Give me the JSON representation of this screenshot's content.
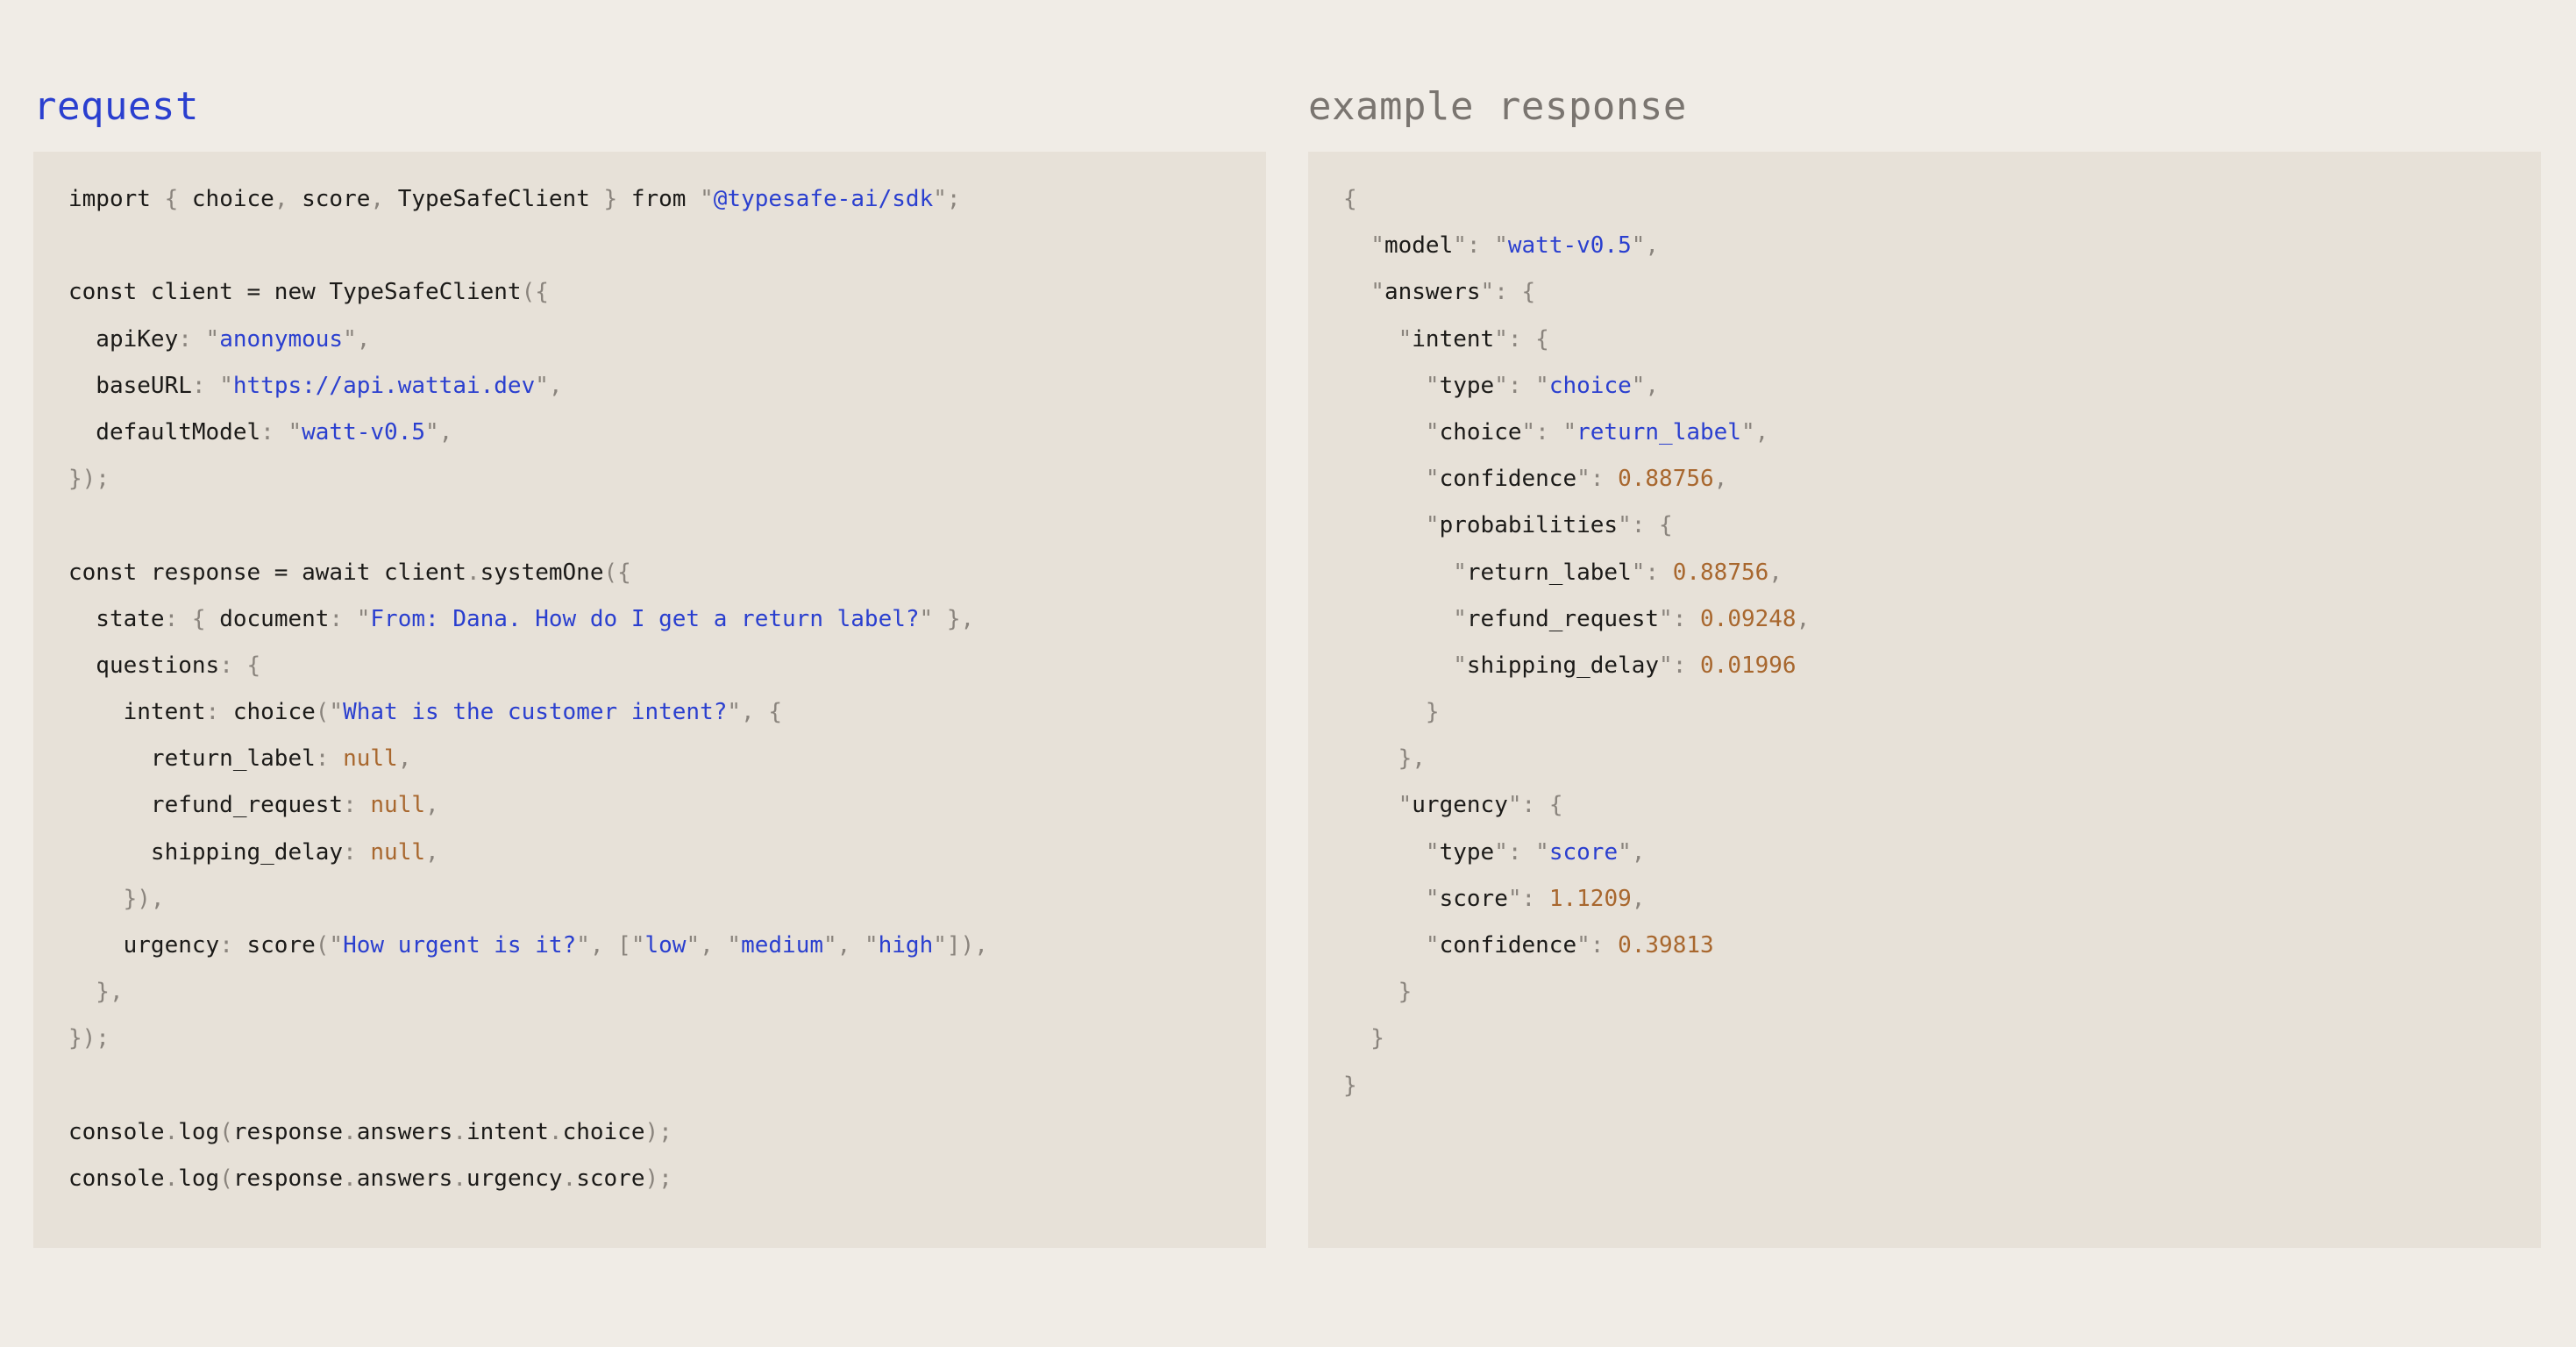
{
  "request": {
    "title": "request",
    "lines": [
      [
        [
          "i",
          "import "
        ],
        [
          "p",
          "{ "
        ],
        [
          "i",
          "choice"
        ],
        [
          "p",
          ", "
        ],
        [
          "i",
          "score"
        ],
        [
          "p",
          ", "
        ],
        [
          "i",
          "TypeSafeClient "
        ],
        [
          "p",
          "} "
        ],
        [
          "i",
          "from "
        ],
        [
          "p",
          "\""
        ],
        [
          "s",
          "@typesafe-ai/sdk"
        ],
        [
          "p",
          "\";"
        ]
      ],
      [],
      [
        [
          "i",
          "const client = new TypeSafeClient"
        ],
        [
          "p",
          "({"
        ]
      ],
      [
        [
          "i",
          "  apiKey"
        ],
        [
          "p",
          ": \""
        ],
        [
          "s",
          "anonymous"
        ],
        [
          "p",
          "\","
        ]
      ],
      [
        [
          "i",
          "  baseURL"
        ],
        [
          "p",
          ": \""
        ],
        [
          "s",
          "https://api.wattai.dev"
        ],
        [
          "p",
          "\","
        ]
      ],
      [
        [
          "i",
          "  defaultModel"
        ],
        [
          "p",
          ": \""
        ],
        [
          "s",
          "watt-v0.5"
        ],
        [
          "p",
          "\","
        ]
      ],
      [
        [
          "p",
          "});"
        ]
      ],
      [],
      [
        [
          "i",
          "const response = await client"
        ],
        [
          "p",
          "."
        ],
        [
          "i",
          "systemOne"
        ],
        [
          "p",
          "({"
        ]
      ],
      [
        [
          "i",
          "  state"
        ],
        [
          "p",
          ": { "
        ],
        [
          "i",
          "document"
        ],
        [
          "p",
          ": \""
        ],
        [
          "s",
          "From: Dana. How do I get a return label?"
        ],
        [
          "p",
          "\" },"
        ]
      ],
      [
        [
          "i",
          "  questions"
        ],
        [
          "p",
          ": {"
        ]
      ],
      [
        [
          "i",
          "    intent"
        ],
        [
          "p",
          ": "
        ],
        [
          "i",
          "choice"
        ],
        [
          "p",
          "(\""
        ],
        [
          "s",
          "What is the customer intent?"
        ],
        [
          "p",
          "\", {"
        ]
      ],
      [
        [
          "i",
          "      return_label"
        ],
        [
          "p",
          ": "
        ],
        [
          "n",
          "null"
        ],
        [
          "p",
          ","
        ]
      ],
      [
        [
          "i",
          "      refund_request"
        ],
        [
          "p",
          ": "
        ],
        [
          "n",
          "null"
        ],
        [
          "p",
          ","
        ]
      ],
      [
        [
          "i",
          "      shipping_delay"
        ],
        [
          "p",
          ": "
        ],
        [
          "n",
          "null"
        ],
        [
          "p",
          ","
        ]
      ],
      [
        [
          "p",
          "    }),"
        ]
      ],
      [
        [
          "i",
          "    urgency"
        ],
        [
          "p",
          ": "
        ],
        [
          "i",
          "score"
        ],
        [
          "p",
          "(\""
        ],
        [
          "s",
          "How urgent is it?"
        ],
        [
          "p",
          "\", [\""
        ],
        [
          "s",
          "low"
        ],
        [
          "p",
          "\", \""
        ],
        [
          "s",
          "medium"
        ],
        [
          "p",
          "\", \""
        ],
        [
          "s",
          "high"
        ],
        [
          "p",
          "\"]),"
        ]
      ],
      [
        [
          "p",
          "  },"
        ]
      ],
      [
        [
          "p",
          "});"
        ]
      ],
      [],
      [
        [
          "i",
          "console"
        ],
        [
          "p",
          "."
        ],
        [
          "i",
          "log"
        ],
        [
          "p",
          "("
        ],
        [
          "i",
          "response"
        ],
        [
          "p",
          "."
        ],
        [
          "i",
          "answers"
        ],
        [
          "p",
          "."
        ],
        [
          "i",
          "intent"
        ],
        [
          "p",
          "."
        ],
        [
          "i",
          "choice"
        ],
        [
          "p",
          ");"
        ]
      ],
      [
        [
          "i",
          "console"
        ],
        [
          "p",
          "."
        ],
        [
          "i",
          "log"
        ],
        [
          "p",
          "("
        ],
        [
          "i",
          "response"
        ],
        [
          "p",
          "."
        ],
        [
          "i",
          "answers"
        ],
        [
          "p",
          "."
        ],
        [
          "i",
          "urgency"
        ],
        [
          "p",
          "."
        ],
        [
          "i",
          "score"
        ],
        [
          "p",
          ");"
        ]
      ]
    ]
  },
  "response": {
    "title": "example response",
    "lines": [
      [
        [
          "p",
          "{"
        ]
      ],
      [
        [
          "p",
          "  \""
        ],
        [
          "i",
          "model"
        ],
        [
          "p",
          "\": \""
        ],
        [
          "s",
          "watt-v0.5"
        ],
        [
          "p",
          "\","
        ]
      ],
      [
        [
          "p",
          "  \""
        ],
        [
          "i",
          "answers"
        ],
        [
          "p",
          "\": {"
        ]
      ],
      [
        [
          "p",
          "    \""
        ],
        [
          "i",
          "intent"
        ],
        [
          "p",
          "\": {"
        ]
      ],
      [
        [
          "p",
          "      \""
        ],
        [
          "i",
          "type"
        ],
        [
          "p",
          "\": \""
        ],
        [
          "s",
          "choice"
        ],
        [
          "p",
          "\","
        ]
      ],
      [
        [
          "p",
          "      \""
        ],
        [
          "i",
          "choice"
        ],
        [
          "p",
          "\": \""
        ],
        [
          "s",
          "return_label"
        ],
        [
          "p",
          "\","
        ]
      ],
      [
        [
          "p",
          "      \""
        ],
        [
          "i",
          "confidence"
        ],
        [
          "p",
          "\": "
        ],
        [
          "n",
          "0.88756"
        ],
        [
          "p",
          ","
        ]
      ],
      [
        [
          "p",
          "      \""
        ],
        [
          "i",
          "probabilities"
        ],
        [
          "p",
          "\": {"
        ]
      ],
      [
        [
          "p",
          "        \""
        ],
        [
          "i",
          "return_label"
        ],
        [
          "p",
          "\": "
        ],
        [
          "n",
          "0.88756"
        ],
        [
          "p",
          ","
        ]
      ],
      [
        [
          "p",
          "        \""
        ],
        [
          "i",
          "refund_request"
        ],
        [
          "p",
          "\": "
        ],
        [
          "n",
          "0.09248"
        ],
        [
          "p",
          ","
        ]
      ],
      [
        [
          "p",
          "        \""
        ],
        [
          "i",
          "shipping_delay"
        ],
        [
          "p",
          "\": "
        ],
        [
          "n",
          "0.01996"
        ]
      ],
      [
        [
          "p",
          "      }"
        ]
      ],
      [
        [
          "p",
          "    },"
        ]
      ],
      [
        [
          "p",
          "    \""
        ],
        [
          "i",
          "urgency"
        ],
        [
          "p",
          "\": {"
        ]
      ],
      [
        [
          "p",
          "      \""
        ],
        [
          "i",
          "type"
        ],
        [
          "p",
          "\": \""
        ],
        [
          "s",
          "score"
        ],
        [
          "p",
          "\","
        ]
      ],
      [
        [
          "p",
          "      \""
        ],
        [
          "i",
          "score"
        ],
        [
          "p",
          "\": "
        ],
        [
          "n",
          "1.1209"
        ],
        [
          "p",
          ","
        ]
      ],
      [
        [
          "p",
          "      \""
        ],
        [
          "i",
          "confidence"
        ],
        [
          "p",
          "\": "
        ],
        [
          "n",
          "0.39813"
        ]
      ],
      [
        [
          "p",
          "    }"
        ]
      ],
      [
        [
          "p",
          "  }"
        ]
      ],
      [
        [
          "p",
          "}"
        ]
      ]
    ]
  },
  "colors": {
    "background": "#f0ece6",
    "code_background": "#e7e1d8",
    "string": "#2a3fcf",
    "number": "#a8672e",
    "punctuation": "#8a847d",
    "identifier": "#1b1a18"
  }
}
